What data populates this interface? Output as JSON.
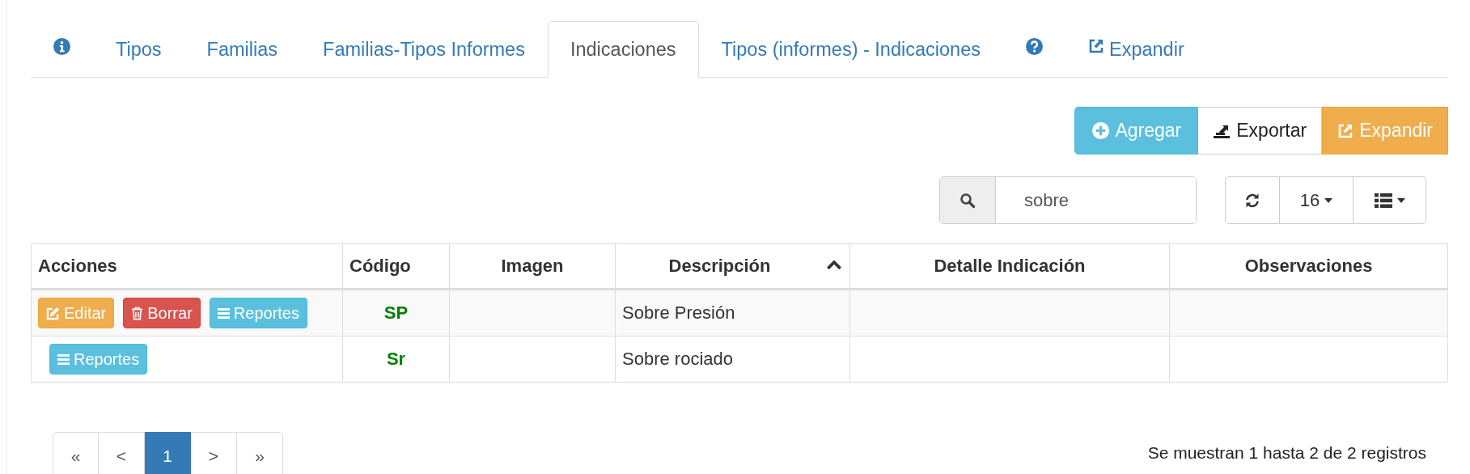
{
  "tabs": [
    {
      "kind": "info",
      "selected": false
    },
    {
      "kind": "text",
      "label": "Tipos",
      "selected": false
    },
    {
      "kind": "text",
      "label": "Familias",
      "selected": false
    },
    {
      "kind": "text",
      "label": "Familias-Tipos Informes",
      "selected": false
    },
    {
      "kind": "text",
      "label": "Indicaciones",
      "selected": true
    },
    {
      "kind": "text",
      "label": "Tipos (informes) - Indicaciones",
      "selected": false
    },
    {
      "kind": "help",
      "selected": false
    },
    {
      "kind": "expand",
      "label": "Expandir",
      "selected": false
    }
  ],
  "toolbar": [
    {
      "kind": "add",
      "label": "Agregar"
    },
    {
      "kind": "export",
      "label": "Exportar"
    },
    {
      "kind": "expand",
      "label": "Expandir"
    }
  ],
  "search": {
    "value": "sobre"
  },
  "page_size": "16",
  "table": {
    "columns": [
      {
        "label": "Acciones",
        "sorted": false
      },
      {
        "label": "Código",
        "sorted": false
      },
      {
        "label": "Imagen",
        "sorted": false
      },
      {
        "label": "Descripción",
        "sorted": true
      },
      {
        "label": "Detalle Indicación",
        "sorted": false
      },
      {
        "label": "Observaciones",
        "sorted": false
      }
    ],
    "rows": [
      {
        "actions": [
          {
            "kind": "edit",
            "label": "Editar"
          },
          {
            "kind": "delete",
            "label": "Borrar"
          },
          {
            "kind": "reports",
            "label": "Reportes"
          }
        ],
        "code": "SP",
        "description": "Sobre Presión"
      },
      {
        "actions": [
          {
            "kind": "reports",
            "label": "Reportes"
          }
        ],
        "code": "Sr",
        "description": "Sobre rociado"
      }
    ]
  },
  "pagination": [
    {
      "label": "«",
      "selected": false
    },
    {
      "label": "<",
      "selected": false
    },
    {
      "label": "1",
      "selected": true
    },
    {
      "label": ">",
      "selected": false
    },
    {
      "label": "»",
      "selected": false
    }
  ],
  "summary": "Se muestran 1 hasta 2 de 2 registros"
}
